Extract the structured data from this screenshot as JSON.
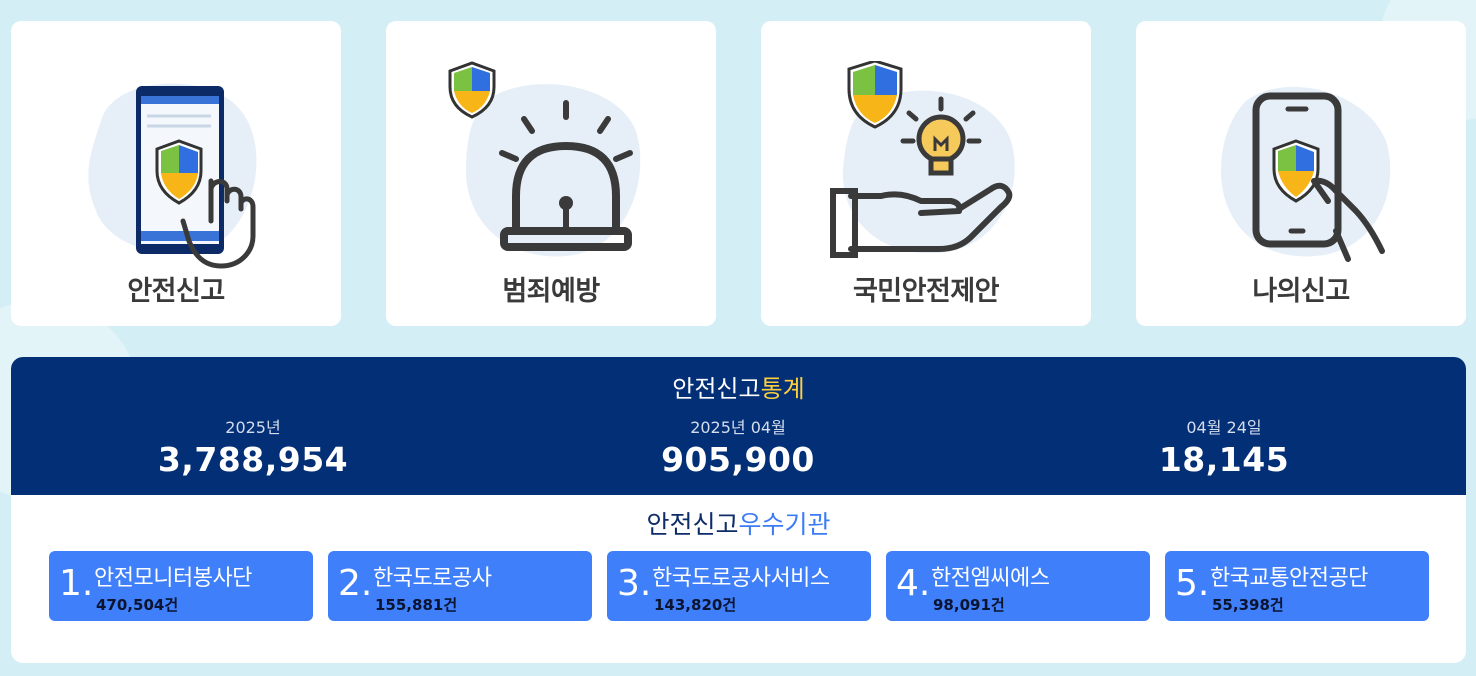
{
  "cards": [
    {
      "label": "안전신고",
      "icon": "phone-report-icon"
    },
    {
      "label": "범죄예방",
      "icon": "siren-icon"
    },
    {
      "label": "국민안전제안",
      "icon": "idea-hand-icon"
    },
    {
      "label": "나의신고",
      "icon": "my-report-phone-icon"
    }
  ],
  "stats": {
    "title_main": "안전신고",
    "title_highlight": "통계",
    "items": [
      {
        "period": "2025년",
        "value": "3,788,954"
      },
      {
        "period": "2025년 04월",
        "value": "905,900"
      },
      {
        "period": "04월 24일",
        "value": "18,145"
      }
    ]
  },
  "orgs": {
    "title_main": "안전신고",
    "title_highlight": "우수기관",
    "items": [
      {
        "rank": "1.",
        "name": "안전모니터봉사단",
        "count": "470,504건"
      },
      {
        "rank": "2.",
        "name": "한국도로공사",
        "count": "155,881건"
      },
      {
        "rank": "3.",
        "name": "한국도로공사서비스",
        "count": "143,820건"
      },
      {
        "rank": "4.",
        "name": "한전엠씨에스",
        "count": "98,091건"
      },
      {
        "rank": "5.",
        "name": "한국교통안전공단",
        "count": "55,398건"
      }
    ]
  },
  "colors": {
    "background": "#d3eff5",
    "stats_header": "#032f76",
    "stats_highlight": "#ffcf3a",
    "org_button": "#3f7ff9",
    "shield_green": "#7cc242",
    "shield_blue": "#2f6fe0",
    "shield_yellow": "#f7b518"
  }
}
